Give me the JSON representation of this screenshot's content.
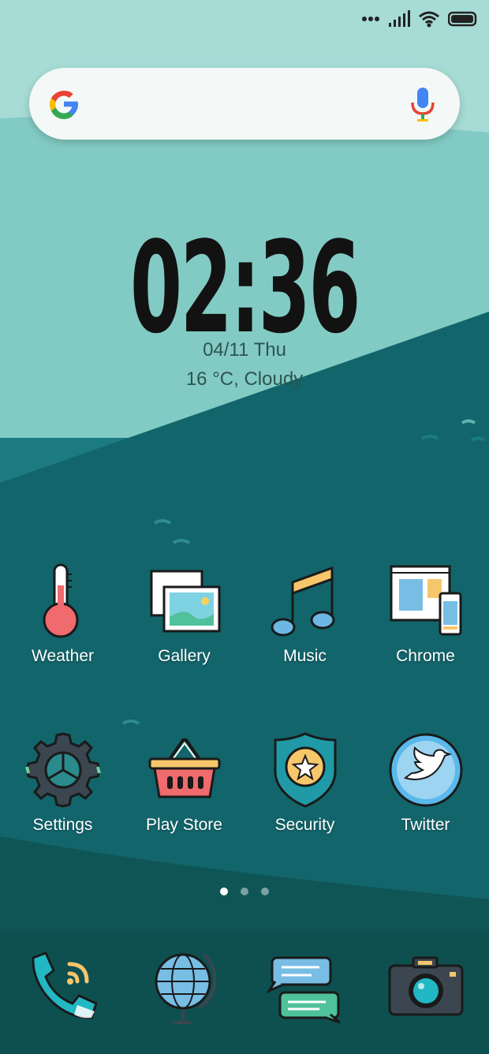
{
  "status_bar": {
    "icons": [
      "more-dots-icon",
      "signal-icon",
      "wifi-icon",
      "battery-icon"
    ]
  },
  "search_bar": {
    "logo": "google-g-icon",
    "voice": "mic-icon"
  },
  "clock": {
    "time": "02:36",
    "date": "04/11  Thu",
    "weather": "16 °C, Cloudy"
  },
  "home_apps": [
    {
      "label": "Weather",
      "icon": "thermometer-icon"
    },
    {
      "label": "Gallery",
      "icon": "pictures-icon"
    },
    {
      "label": "Music",
      "icon": "music-note-icon"
    },
    {
      "label": "Chrome",
      "icon": "browser-devices-icon"
    },
    {
      "label": "Settings",
      "icon": "gear-icon"
    },
    {
      "label": "Play Store",
      "icon": "basket-icon"
    },
    {
      "label": "Security",
      "icon": "shield-star-icon"
    },
    {
      "label": "Twitter",
      "icon": "twitter-bird-icon"
    }
  ],
  "page_indicator": {
    "pages": 3,
    "current": 1
  },
  "dock": [
    {
      "icon": "phone-icon"
    },
    {
      "icon": "globe-icon"
    },
    {
      "icon": "messages-icon"
    },
    {
      "icon": "camera-icon"
    }
  ],
  "colors": {
    "sky": "#a6dbd6",
    "wave_mid": "#7ec9c3",
    "water_top": "#187a7f",
    "water_deep": "#0f5e64",
    "bottom": "#0d4d4e"
  }
}
